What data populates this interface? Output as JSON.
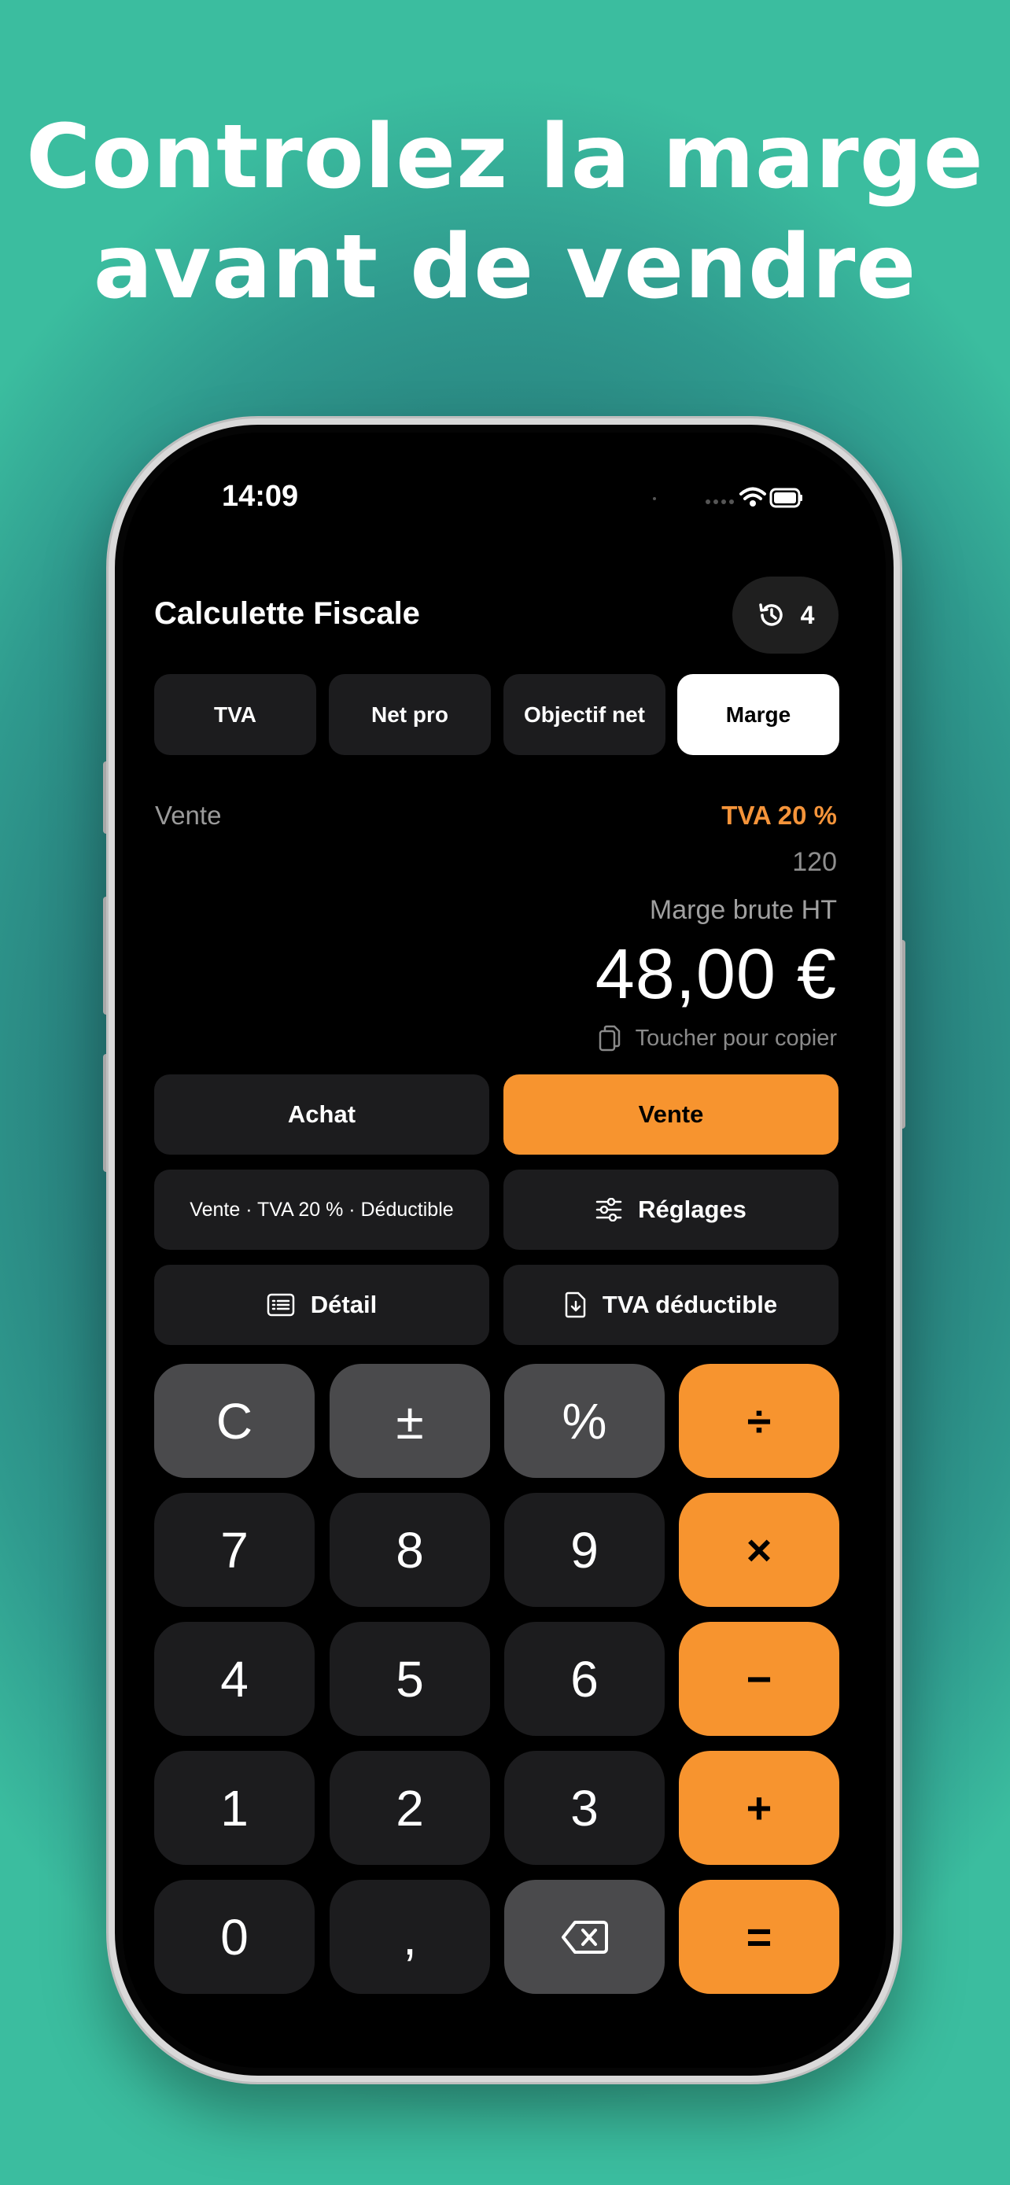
{
  "headline": {
    "line1": "Controlez la marge",
    "line2": "avant de vendre"
  },
  "status_bar": {
    "time": "14:09"
  },
  "app": {
    "title": "Calculette Fiscale",
    "history_count": "4",
    "modes": [
      "TVA",
      "Net pro",
      "Objectif net",
      "Marge"
    ],
    "active_mode": "Marge"
  },
  "display": {
    "field_label": "Vente",
    "tva_rate": "TVA 20 %",
    "input_value": "120",
    "result_label": "Marge brute HT",
    "result_value": "48,00 €",
    "copy_hint": "Toucher pour copier"
  },
  "controls": {
    "achat": "Achat",
    "vente": "Vente",
    "summary": "Vente · TVA 20 % · Déductible",
    "reglages": "Réglages",
    "detail": "Détail",
    "tva_deductible": "TVA déductible"
  },
  "keypad": {
    "clear": "C",
    "plus_minus": "±",
    "percent": "%",
    "divide": "÷",
    "seven": "7",
    "eight": "8",
    "nine": "9",
    "multiply": "×",
    "four": "4",
    "five": "5",
    "six": "6",
    "minus": "−",
    "one": "1",
    "two": "2",
    "three": "3",
    "plus": "+",
    "zero": "0",
    "comma": ",",
    "equals": "="
  },
  "colors": {
    "accent": "#f7942f",
    "background_top": "#3bbd9f",
    "background_center": "#1b5560"
  }
}
